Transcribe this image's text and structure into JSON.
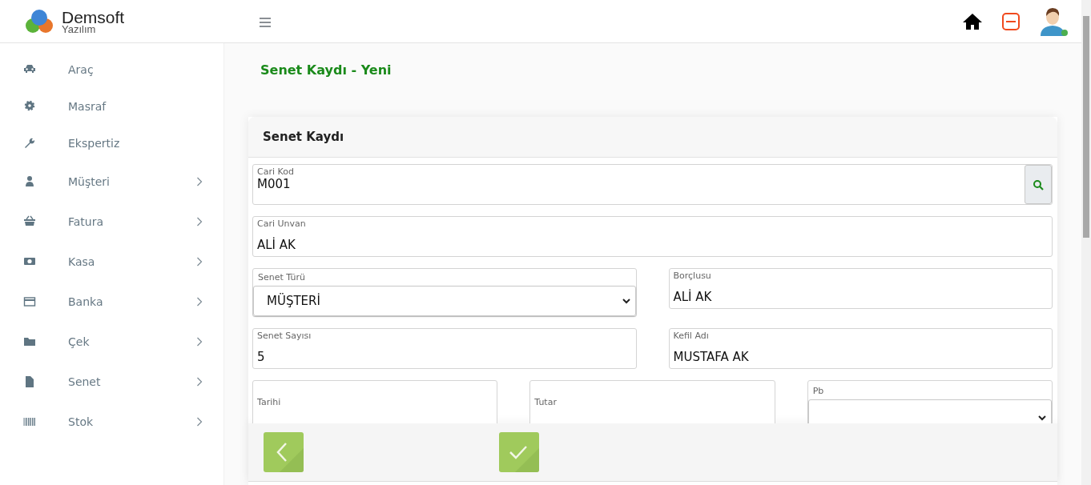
{
  "brand": {
    "name": "Demsoft",
    "tagline": "Yazılım"
  },
  "sidebar": {
    "items": [
      {
        "label": "Araç",
        "submenu": false
      },
      {
        "label": "Masraf",
        "submenu": false
      },
      {
        "label": "Ekspertiz",
        "submenu": false
      },
      {
        "label": "Müşteri",
        "submenu": true
      },
      {
        "label": "Fatura",
        "submenu": true
      },
      {
        "label": "Kasa",
        "submenu": true
      },
      {
        "label": "Banka",
        "submenu": true
      },
      {
        "label": "Çek",
        "submenu": true
      },
      {
        "label": "Senet",
        "submenu": true
      },
      {
        "label": "Stok",
        "submenu": true
      }
    ]
  },
  "page_title": "Senet Kaydı - Yeni",
  "panel": {
    "title": "Senet Kaydı",
    "rows": [
      [
        {
          "kind": "lookup",
          "label": "Cari Kod",
          "value": "M001"
        }
      ],
      [
        {
          "kind": "text",
          "label": "Cari Unvan",
          "value": "ALİ AK"
        }
      ],
      [
        {
          "kind": "select",
          "label": "Senet Türü",
          "value": "MÜŞTERİ"
        },
        {
          "kind": "text",
          "label": "Borçlusu",
          "value": "ALİ AK"
        }
      ],
      [
        {
          "kind": "text",
          "label": "Senet Sayısı",
          "value": "5"
        },
        {
          "kind": "text",
          "label": "Kefil Adı",
          "value": "MUSTAFA AK"
        }
      ],
      [
        {
          "kind": "text",
          "label": "Tarihi"
        },
        {
          "kind": "text",
          "label": "Tutar"
        },
        {
          "kind": "select",
          "label": "Pb"
        }
      ]
    ]
  },
  "footer_buttons": [
    {
      "kind": "back"
    },
    {
      "kind": "check"
    }
  ]
}
